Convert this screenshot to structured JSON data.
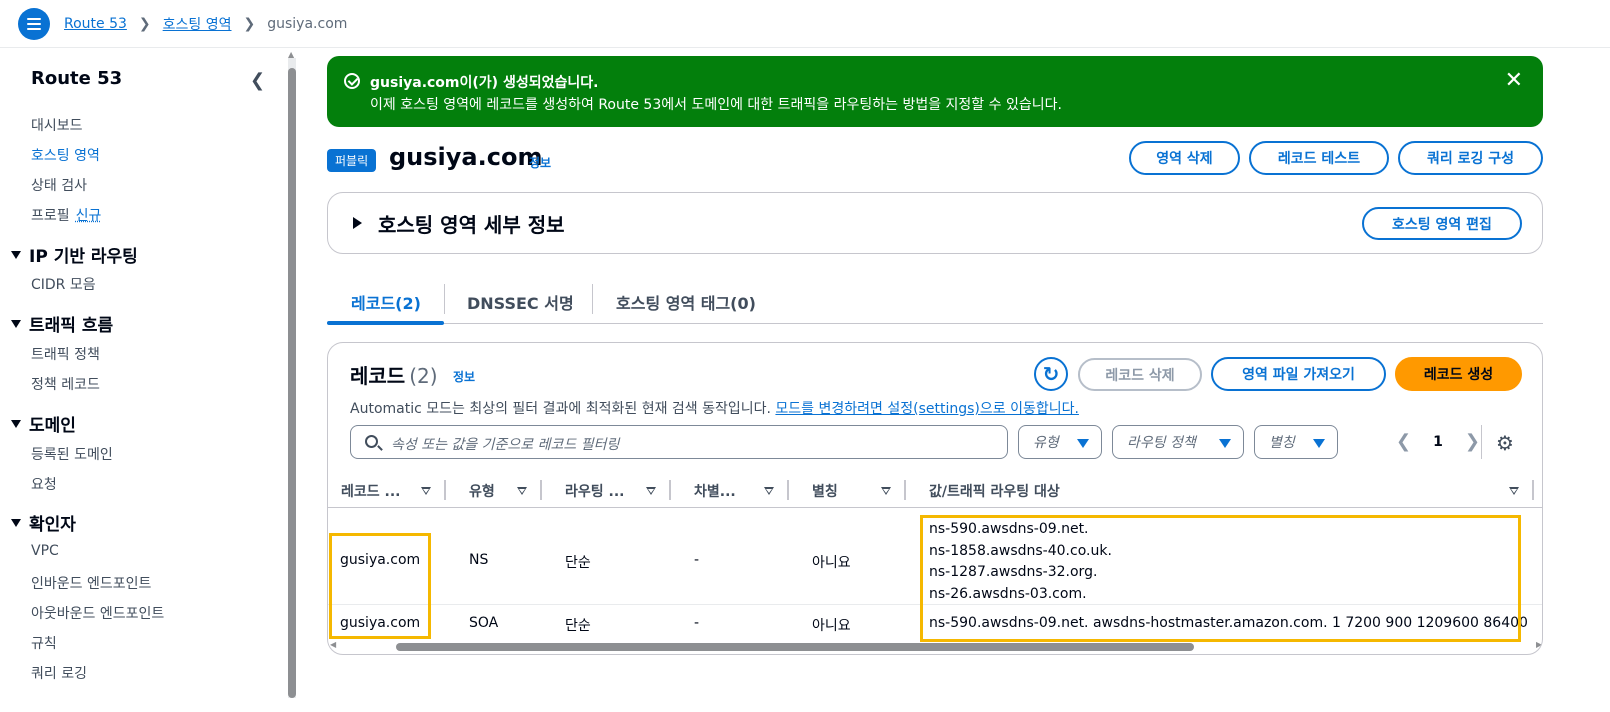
{
  "breadcrumb": {
    "items": [
      "Route 53",
      "호스팅 영역"
    ],
    "current": "gusiya.com"
  },
  "sidebar": {
    "title": "Route 53",
    "top_items": [
      {
        "label": "대시보드"
      },
      {
        "label": "호스팅 영역",
        "active": true
      },
      {
        "label": "상태 검사"
      },
      {
        "label": "프로필",
        "badge": "신규"
      }
    ],
    "sections": [
      {
        "title": "IP 기반 라우팅",
        "items": [
          "CIDR 모음"
        ]
      },
      {
        "title": "트래픽 흐름",
        "items": [
          "트래픽 정책",
          "정책 레코드"
        ]
      },
      {
        "title": "도메인",
        "items": [
          "등록된 도메인",
          "요청"
        ]
      },
      {
        "title": "확인자",
        "items": [
          "VPC",
          "인바운드 엔드포인트",
          "아웃바운드 엔드포인트",
          "규칙",
          "쿼리 로깅"
        ]
      }
    ]
  },
  "flash": {
    "title": "gusiya.com이(가) 생성되었습니다.",
    "message": "이제 호스팅 영역에 레코드를 생성하여 Route 53에서 도메인에 대한 트래픽을 라우팅하는 방법을 지정할 수 있습니다."
  },
  "header": {
    "badge": "퍼블릭",
    "title": "gusiya.com",
    "info": "정보",
    "buttons": {
      "delete_zone": "영역 삭제",
      "test_record": "레코드 테스트",
      "query_logging": "쿼리 로깅 구성"
    }
  },
  "details": {
    "title": "호스팅 영역 세부 정보",
    "edit_button": "호스팅 영역 편집"
  },
  "tabs": [
    {
      "label": "레코드(2)",
      "active": true
    },
    {
      "label": "DNSSEC 서명"
    },
    {
      "label": "호스팅 영역 태그(0)"
    }
  ],
  "records": {
    "title": "레코드",
    "count": "(2)",
    "info": "정보",
    "description": "Automatic 모드는 최상의 필터 결과에 최적화된 현재 검색 동작입니다.",
    "description_link": "모드를 변경하려면 설정(settings)으로 이동합니다.",
    "buttons": {
      "delete": "레코드 삭제",
      "import": "영역 파일 가져오기",
      "create": "레코드 생성"
    },
    "search_placeholder": "속성 또는 값을 기준으로 레코드 필터링",
    "filters": [
      "유형",
      "라우팅 정책",
      "별칭"
    ],
    "page": "1",
    "columns": [
      "레코드 ...",
      "유형",
      "라우팅 ...",
      "차별...",
      "별칭",
      "값/트래픽 라우팅 대상"
    ],
    "rows": [
      {
        "name": "gusiya.com",
        "type": "NS",
        "routing": "단순",
        "diff": "-",
        "alias": "아니요",
        "values": [
          "ns-590.awsdns-09.net.",
          "ns-1858.awsdns-40.co.uk.",
          "ns-1287.awsdns-32.org.",
          "ns-26.awsdns-03.com."
        ]
      },
      {
        "name": "gusiya.com",
        "type": "SOA",
        "routing": "단순",
        "diff": "-",
        "alias": "아니요",
        "values": [
          "ns-590.awsdns-09.net. awsdns-hostmaster.amazon.com. 1 7200 900 1209600 86400"
        ]
      }
    ]
  },
  "colors": {
    "accent": "#0972d3",
    "success": "#037f0c",
    "primary_button": "#ff9900",
    "highlight": "#f5b800"
  }
}
